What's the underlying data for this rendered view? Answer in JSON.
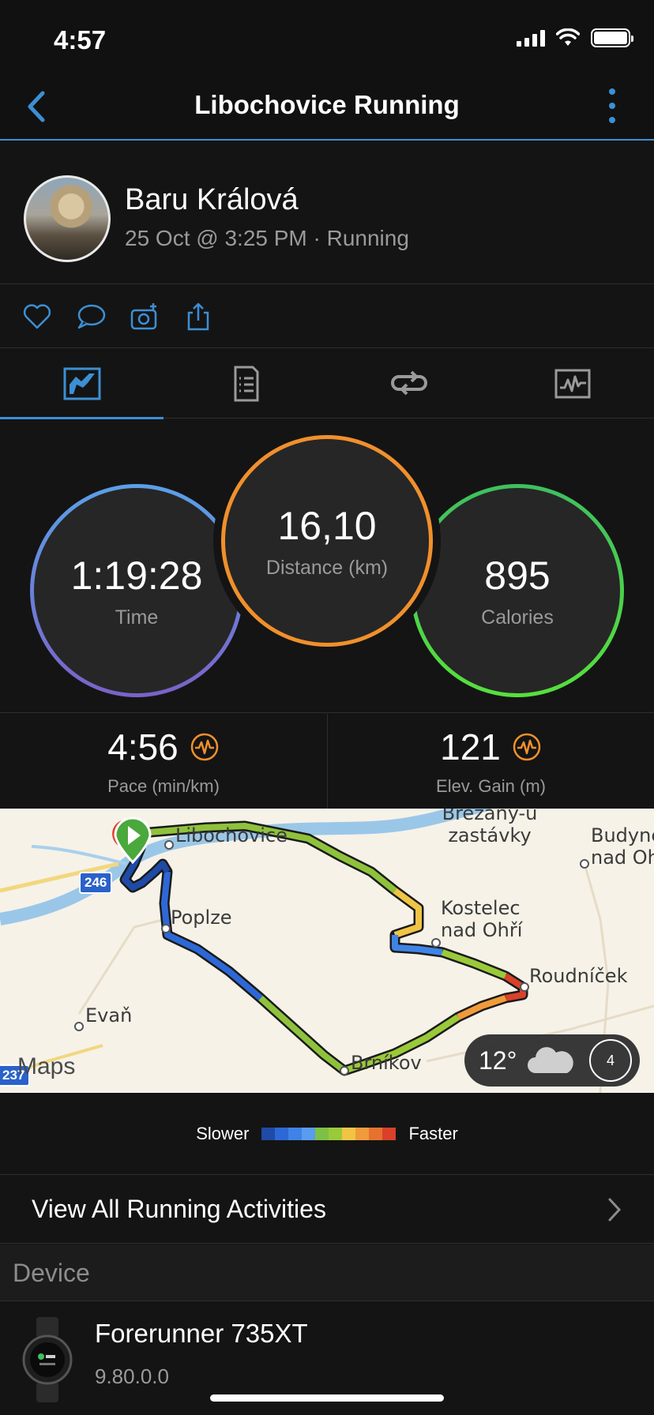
{
  "status_bar": {
    "time": "4:57"
  },
  "nav": {
    "title": "Libochovice Running"
  },
  "profile": {
    "name": "Baru Králová",
    "meta": "25 Oct @ 3:25 PM · Running"
  },
  "actions": [
    "heart-icon",
    "comment-icon",
    "add-photo-icon",
    "share-icon"
  ],
  "tabs": [
    {
      "icon": "overview-icon",
      "active": true
    },
    {
      "icon": "details-icon",
      "active": false
    },
    {
      "icon": "laps-icon",
      "active": false
    },
    {
      "icon": "charts-icon",
      "active": false
    }
  ],
  "stats": {
    "time": {
      "value": "1:19:28",
      "label": "Time"
    },
    "distance": {
      "value": "16,10",
      "label": "Distance (km)"
    },
    "calories": {
      "value": "895",
      "label": "Calories"
    }
  },
  "metrics": {
    "pace": {
      "value": "4:56",
      "label": "Pace (min/km)"
    },
    "elevation": {
      "value": "121",
      "label": "Elev. Gain (m)"
    }
  },
  "map": {
    "labels": {
      "libochovice": "Libochovice",
      "poplze": "Poplze",
      "evan": "Evaň",
      "kostelec": "Kostelec nad Ohří",
      "roudnicek": "Roudníček",
      "brnikov": "Brníkov",
      "brezany": "Břežany-u zastávky",
      "budyne": "Budyně nad Oh"
    },
    "road_badges": {
      "r246": "246",
      "r237": "237"
    },
    "maps_logo": "Maps",
    "weather": {
      "temp": "12°",
      "wind": "4"
    }
  },
  "legend": {
    "slower": "Slower",
    "faster": "Faster",
    "colors": [
      "#1f4aa6",
      "#2d68d6",
      "#3f83e6",
      "#5a9cf0",
      "#7cc048",
      "#9ac93a",
      "#f0c445",
      "#ef9b3c",
      "#e5722f",
      "#d9412a"
    ]
  },
  "view_all": {
    "label": "View All Running Activities"
  },
  "device_section": {
    "header": "Device"
  },
  "device": {
    "name": "Forerunner 735XT",
    "version": "9.80.0.0"
  },
  "colors": {
    "accent": "#3d8fd4",
    "distance_ring": "#f0902c",
    "calories_ring": "#56e03c",
    "time_ring": "#5aa0e8"
  }
}
